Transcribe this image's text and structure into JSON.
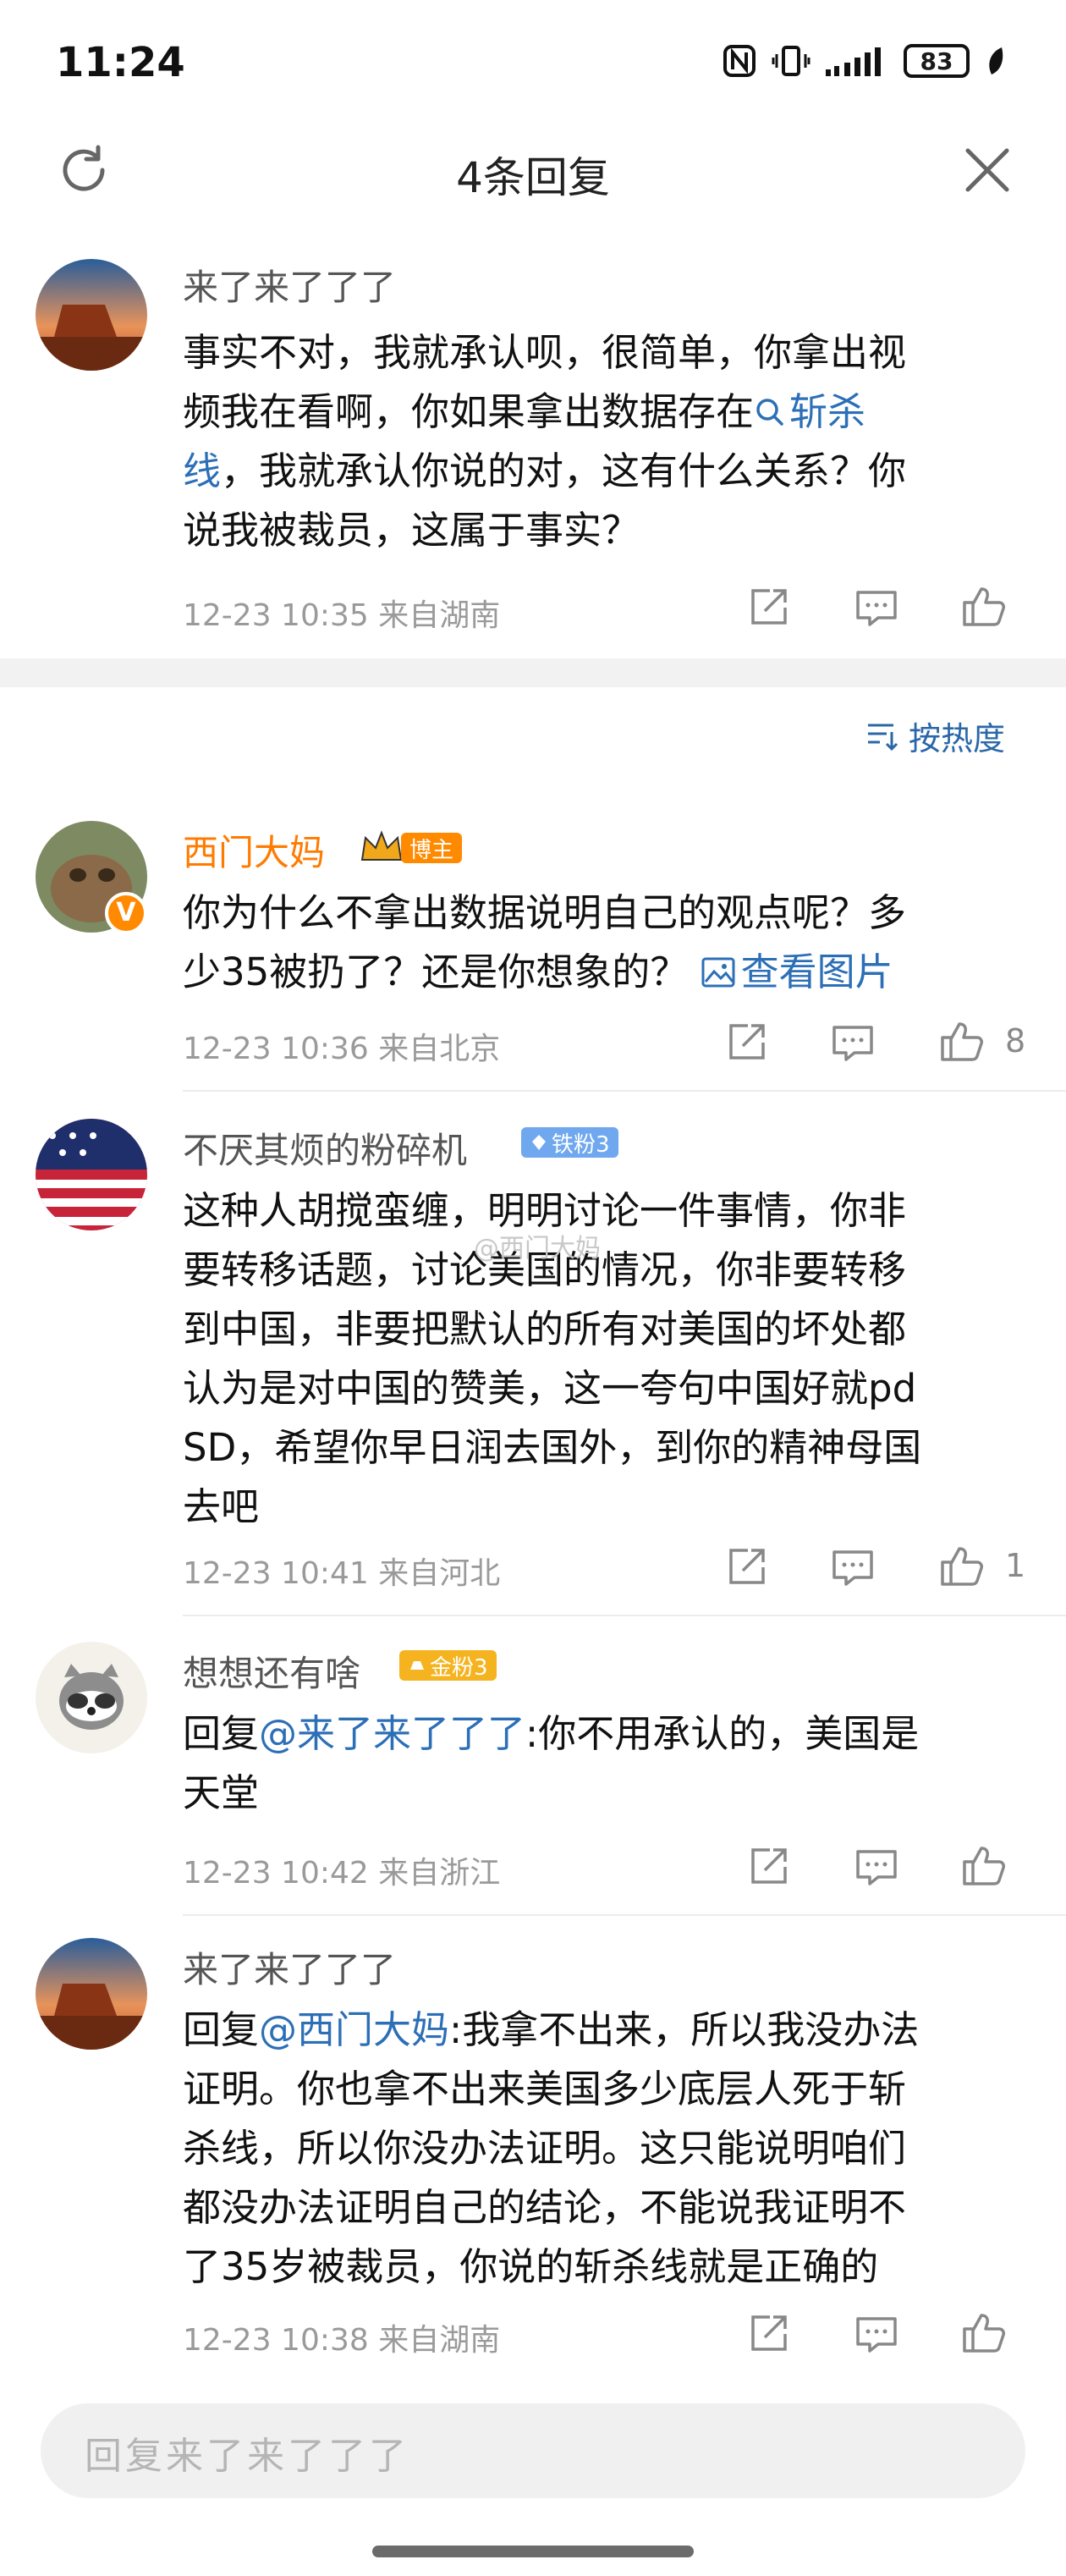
{
  "status_bar": {
    "time": "11:24",
    "battery": "83"
  },
  "header": {
    "title": "4条回复",
    "left_icon": "refresh-icon",
    "right_icon": "close-icon"
  },
  "root_comment": {
    "user": "来了来了了了",
    "text_1": "事实不对，我就承认呗，很简单，你拿出视",
    "text_2a": "频我在看啊，你如果拿出数据存在",
    "link": "斩杀",
    "text_3a": "线",
    "text_3b": "，我就承认你说的对，这有什么关系？你",
    "text_4": "说我被裁员，这属于事实？",
    "meta": "12-23 10:35 来自湖南"
  },
  "sort": {
    "label": "按热度"
  },
  "replies": [
    {
      "user": "西门大妈",
      "badge": "博主",
      "badge_color": "#ff8a00",
      "line_1": "你为什么不拿出数据说明自己的观点呢？多",
      "line_2": "少35被扔了？还是你想象的？",
      "link": "查看图片",
      "meta": "12-23 10:36 来自北京",
      "likes": "8"
    },
    {
      "user": "不厌其烦的粉碎机",
      "badge": "铁粉3",
      "badge_color": "#6fa8ef",
      "lines": [
        "这种人胡搅蛮缠，明明讨论一件事情，你非",
        "要转移话题，讨论美国的情况，你非要转移",
        "到中国，非要把默认的所有对美国的坏处都",
        "认为是对中国的赞美，这一夸句中国好就pd",
        "SD，希望你早日润去国外，到你的精神母国",
        "去吧"
      ],
      "meta": "12-23 10:41 来自河北",
      "likes": "1"
    },
    {
      "user": "想想还有啥",
      "badge": "金粉3",
      "badge_color": "#f5b320",
      "reply_prefix": "回复",
      "mention": "@来了来了了了",
      "line_1_rest": ":你不用承认的，美国是",
      "line_2": "天堂",
      "meta": "12-23 10:42 来自浙江"
    },
    {
      "user": "来了来了了了",
      "reply_prefix": "回复",
      "mention": "@西门大妈",
      "line_1_rest": ":我拿不出来，所以我没办法",
      "lines": [
        "证明。你也拿不出来美国多少底层人死于斩",
        "杀线，所以你没办法证明。这只能说明咱们",
        "都没办法证明自己的结论，不能说我证明不",
        "了35岁被裁员，你说的斩杀线就是正确的"
      ],
      "meta": "12-23 10:38 来自湖南"
    }
  ],
  "watermark": "@西门大妈",
  "input": {
    "placeholder": "回复来了来了了了"
  },
  "colors": {
    "link": "#2c6fb7",
    "meta": "#9a9a9a",
    "highlight_name": "#ff7b00"
  }
}
